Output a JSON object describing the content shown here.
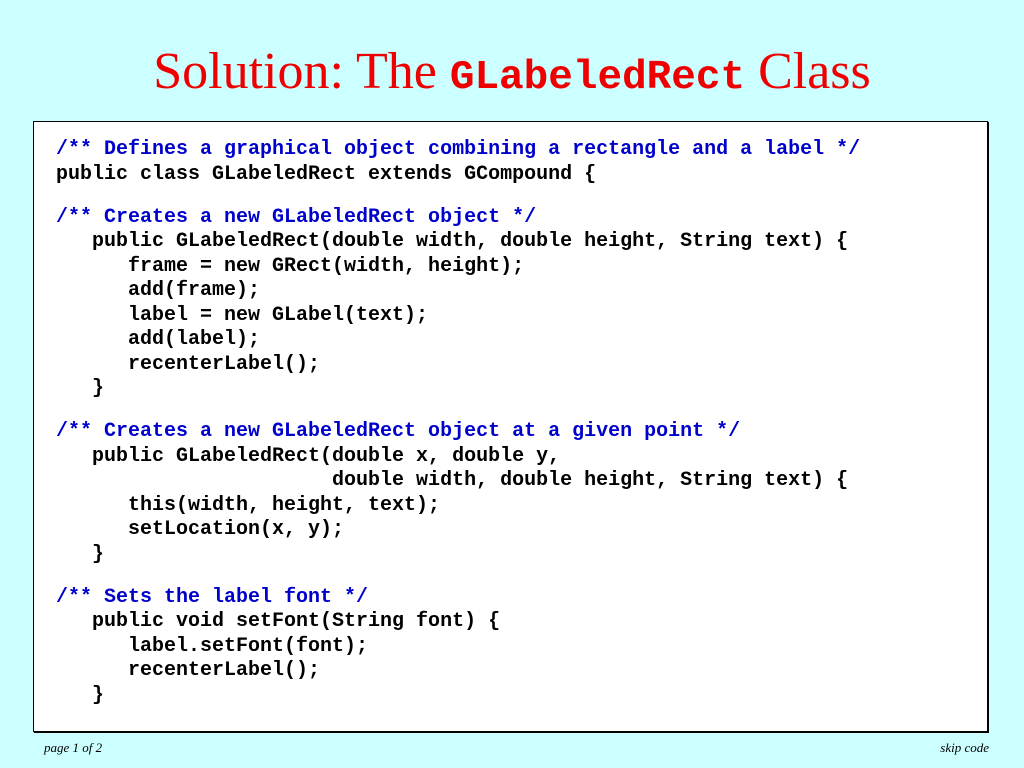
{
  "slide": {
    "title_prefix": "Solution: The ",
    "title_code": "GLabeledRect",
    "title_suffix": " Class",
    "title_color": "#ee0000",
    "comment_color": "#0000cc",
    "background_color": "#ccffff"
  },
  "code_blocks": [
    {
      "lines": [
        {
          "text": "/** Defines a graphical object combining a rectangle and a label */",
          "type": "comment"
        },
        {
          "text": "public class GLabeledRect extends GCompound {",
          "type": "code"
        }
      ]
    },
    {
      "lines": [
        {
          "text": "/** Creates a new GLabeledRect object */",
          "type": "comment"
        },
        {
          "text": "   public GLabeledRect(double width, double height, String text) {",
          "type": "code"
        },
        {
          "text": "      frame = new GRect(width, height);",
          "type": "code"
        },
        {
          "text": "      add(frame);",
          "type": "code"
        },
        {
          "text": "      label = new GLabel(text);",
          "type": "code"
        },
        {
          "text": "      add(label);",
          "type": "code"
        },
        {
          "text": "      recenterLabel();",
          "type": "code"
        },
        {
          "text": "   }",
          "type": "code"
        }
      ]
    },
    {
      "lines": [
        {
          "text": "/** Creates a new GLabeledRect object at a given point */",
          "type": "comment"
        },
        {
          "text": "   public GLabeledRect(double x, double y,",
          "type": "code"
        },
        {
          "text": "                       double width, double height, String text) {",
          "type": "code"
        },
        {
          "text": "      this(width, height, text);",
          "type": "code"
        },
        {
          "text": "      setLocation(x, y);",
          "type": "code"
        },
        {
          "text": "   }",
          "type": "code"
        }
      ]
    },
    {
      "lines": [
        {
          "text": "/** Sets the label font */",
          "type": "comment"
        },
        {
          "text": "   public void setFont(String font) {",
          "type": "code"
        },
        {
          "text": "      label.setFont(font);",
          "type": "code"
        },
        {
          "text": "      recenterLabel();",
          "type": "code"
        },
        {
          "text": "   }",
          "type": "code"
        }
      ]
    }
  ],
  "footer": {
    "page_indicator": "page 1 of 2",
    "skip_link": "skip code"
  }
}
